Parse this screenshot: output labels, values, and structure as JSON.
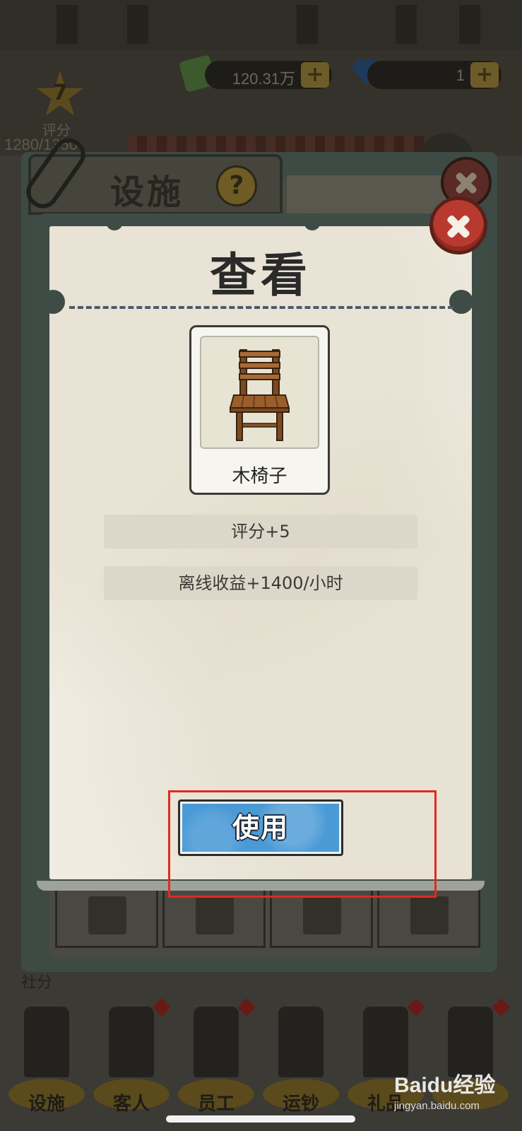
{
  "background": {
    "currency_money": "120.31万",
    "currency_gems": "1",
    "plus_symbol": "+",
    "level": "7",
    "rating_label": "评分",
    "rating_value": "1280/1350",
    "panel_title": "设施",
    "help_symbol": "?",
    "sub_label": "社分",
    "nav": [
      {
        "label": "设施"
      },
      {
        "label": "客人"
      },
      {
        "label": "员工"
      },
      {
        "label": "运钞"
      },
      {
        "label": "礼品"
      },
      {
        "label": ""
      }
    ]
  },
  "dialog": {
    "title": "查看",
    "item": {
      "name": "木椅子",
      "icon": "wooden-chair"
    },
    "stats": [
      {
        "text": "评分+5"
      },
      {
        "text": "离线收益+1400/小时"
      }
    ],
    "use_button_label": "使用",
    "close_icon": "close-icon"
  },
  "watermark": {
    "main": "Baidu经验",
    "sub": "jingyan.baidu.com"
  },
  "colors": {
    "close_red": "#b83a2e",
    "use_blue": "#4a9ad6",
    "highlight_red": "#e02a22",
    "paper": "#efebe0"
  }
}
